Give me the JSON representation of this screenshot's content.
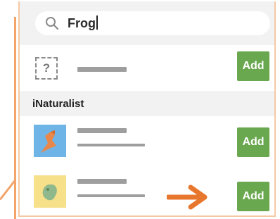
{
  "search": {
    "query": "Frog"
  },
  "unknown_result": {
    "icon_glyph": "?",
    "add_label": "Add"
  },
  "section": {
    "title": "iNaturalist"
  },
  "results": [
    {
      "icon": "bird-thumbnail-icon",
      "add_label": "Add"
    },
    {
      "icon": "frog-thumbnail-icon",
      "add_label": "Add"
    }
  ],
  "colors": {
    "accent_orange": "#e8772e",
    "add_green": "#6aa84f",
    "panel_border": "#f6c9a5"
  }
}
